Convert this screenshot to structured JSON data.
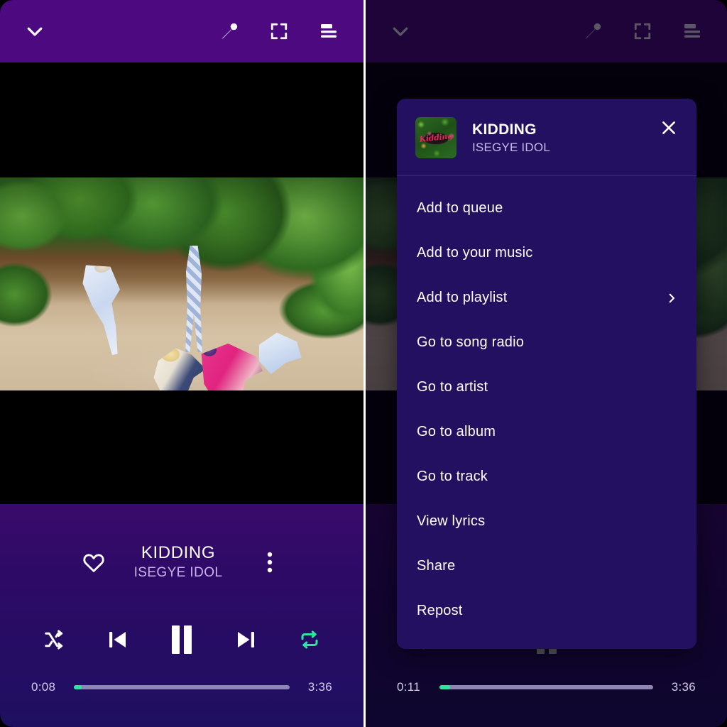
{
  "app": {
    "accent_green": "#2ee59d",
    "header_purple": "#4d0a80",
    "menu_bg": "#241060"
  },
  "topbar": {
    "collapse_icon": "chevron-down-icon",
    "lyrics_icon": "microphone-icon",
    "fullscreen_icon": "fullscreen-icon",
    "queue_icon": "queue-list-icon"
  },
  "left_panel": {
    "now_playing": {
      "title": "KIDDING",
      "artist": "ISEGYE IDOL",
      "like_icon": "heart-icon",
      "more_icon": "more-vertical-icon"
    },
    "controls": {
      "shuffle": "shuffle-icon",
      "previous": "previous-track-icon",
      "play_pause": "pause-icon",
      "next": "next-track-icon",
      "repeat": "repeat-icon"
    },
    "seek": {
      "elapsed": "0:08",
      "duration": "3:36",
      "progress_percent": 3.7
    }
  },
  "right_panel": {
    "now_playing": {
      "title": "KIDDING",
      "artist": "ISEGYE IDOL"
    },
    "seek": {
      "elapsed": "0:11",
      "duration": "3:36",
      "progress_percent": 5.1
    },
    "context_menu": {
      "album_art_logo": "Kidding",
      "title": "KIDDING",
      "artist": "ISEGYE IDOL",
      "close_icon": "close-icon",
      "items": [
        {
          "label": "Add to queue",
          "submenu": false
        },
        {
          "label": "Add to your music",
          "submenu": false
        },
        {
          "label": "Add to playlist",
          "submenu": true
        },
        {
          "label": "Go to song radio",
          "submenu": false
        },
        {
          "label": "Go to artist",
          "submenu": false
        },
        {
          "label": "Go to album",
          "submenu": false
        },
        {
          "label": "Go to track",
          "submenu": false
        },
        {
          "label": "View lyrics",
          "submenu": false
        },
        {
          "label": "Share",
          "submenu": false
        },
        {
          "label": "Repost",
          "submenu": false
        }
      ]
    }
  }
}
